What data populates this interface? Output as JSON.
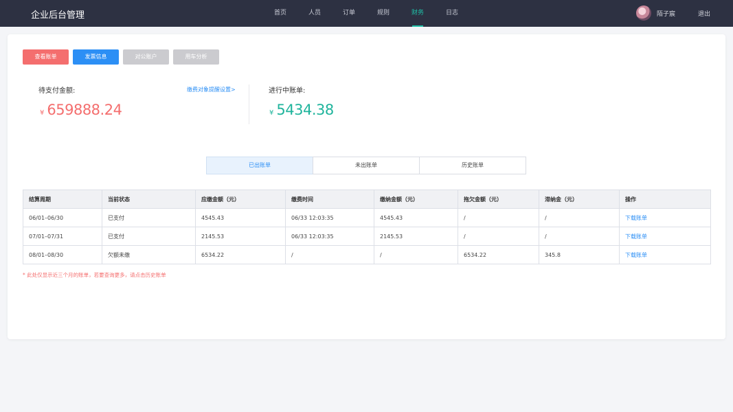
{
  "app": {
    "title": "企业后台管理"
  },
  "nav": {
    "items": [
      "首页",
      "人员",
      "订单",
      "规则",
      "财务",
      "日志"
    ],
    "active": "财务"
  },
  "user": {
    "name": "陌子宸",
    "logout": "退出"
  },
  "actions": {
    "view_bill": "查看账单",
    "invoice_info": "发票信息",
    "corporate_account": "对公账户",
    "car_usage_analysis": "用车分析"
  },
  "summary": {
    "pending_label": "待支付金额:",
    "pending_currency": "¥",
    "pending_amount": "659888.24",
    "remind_link": "缴费对象提醒设置>",
    "in_progress_label": "进行中账单:",
    "in_progress_currency": "¥",
    "in_progress_amount": "5434.38"
  },
  "tabs": [
    "已出账单",
    "未出账单",
    "历史账单"
  ],
  "active_tab": "已出账单",
  "table": {
    "headers": [
      "结算周期",
      "当前状态",
      "应缴金额（元）",
      "缴费时间",
      "缴纳金额（元）",
      "拖欠金额（元）",
      "滞纳金（元）",
      "操作"
    ],
    "rows": [
      [
        "06/01–06/30",
        "已支付",
        "4545.43",
        "06/33   12:03:35",
        "4545.43",
        "/",
        "/",
        "下载账单"
      ],
      [
        "07/01–07/31",
        "已支付",
        "2145.53",
        "06/33   12:03:35",
        "2145.53",
        "/",
        "/",
        "下载账单"
      ],
      [
        "08/01–08/30",
        "欠额未缴",
        "6534.22",
        "/",
        "/",
        "6534.22",
        "345.8",
        "下载账单"
      ]
    ]
  },
  "note": "* 此处仅显示近三个月的账单，若要查询更多，请点击历史账单",
  "colors": {
    "topbar": "#2d3142",
    "accent_teal": "#1fc0a8",
    "red": "#f46e6e",
    "blue": "#2c8ff5"
  }
}
